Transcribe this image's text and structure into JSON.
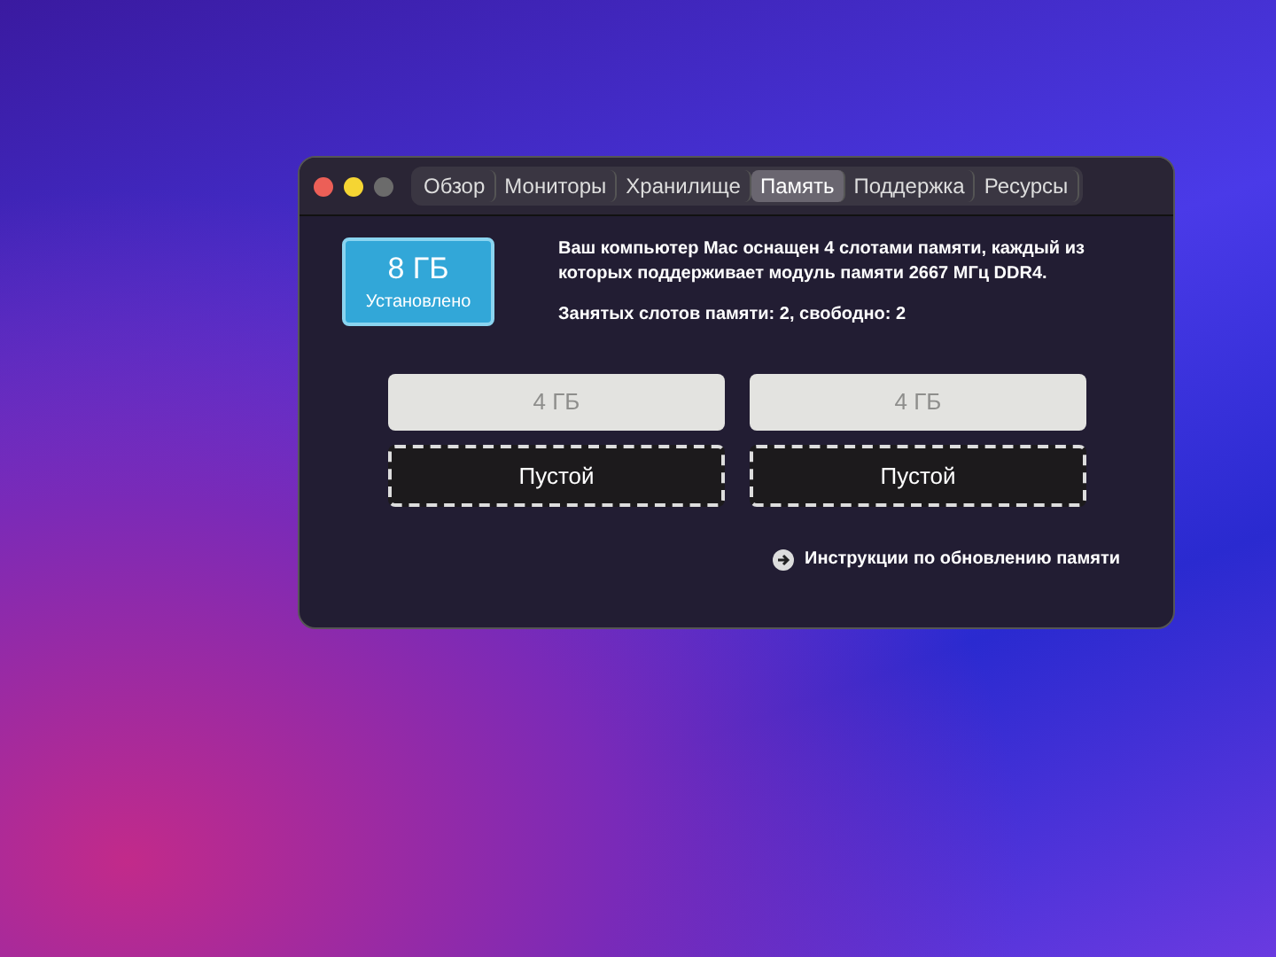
{
  "window": {
    "tabs": [
      {
        "label": "Обзор",
        "selected": false
      },
      {
        "label": "Мониторы",
        "selected": false
      },
      {
        "label": "Хранилище",
        "selected": false
      },
      {
        "label": "Память",
        "selected": true
      },
      {
        "label": "Поддержка",
        "selected": false
      },
      {
        "label": "Ресурсы",
        "selected": false
      }
    ]
  },
  "memory": {
    "size": "8 ГБ",
    "status": "Установлено",
    "description": "Ваш компьютер Mac оснащен 4 слотами памяти, каждый из которых поддерживает модуль памяти 2667 МГц DDR4.",
    "slots_summary": "Занятых слотов памяти: 2, свободно: 2"
  },
  "slots": [
    {
      "kind": "filled",
      "label": "4 ГБ"
    },
    {
      "kind": "filled",
      "label": "4 ГБ"
    },
    {
      "kind": "empty",
      "label": "Пустой"
    },
    {
      "kind": "empty",
      "label": "Пустой"
    }
  ],
  "upgrade_link": "Инструкции по обновлению памяти"
}
